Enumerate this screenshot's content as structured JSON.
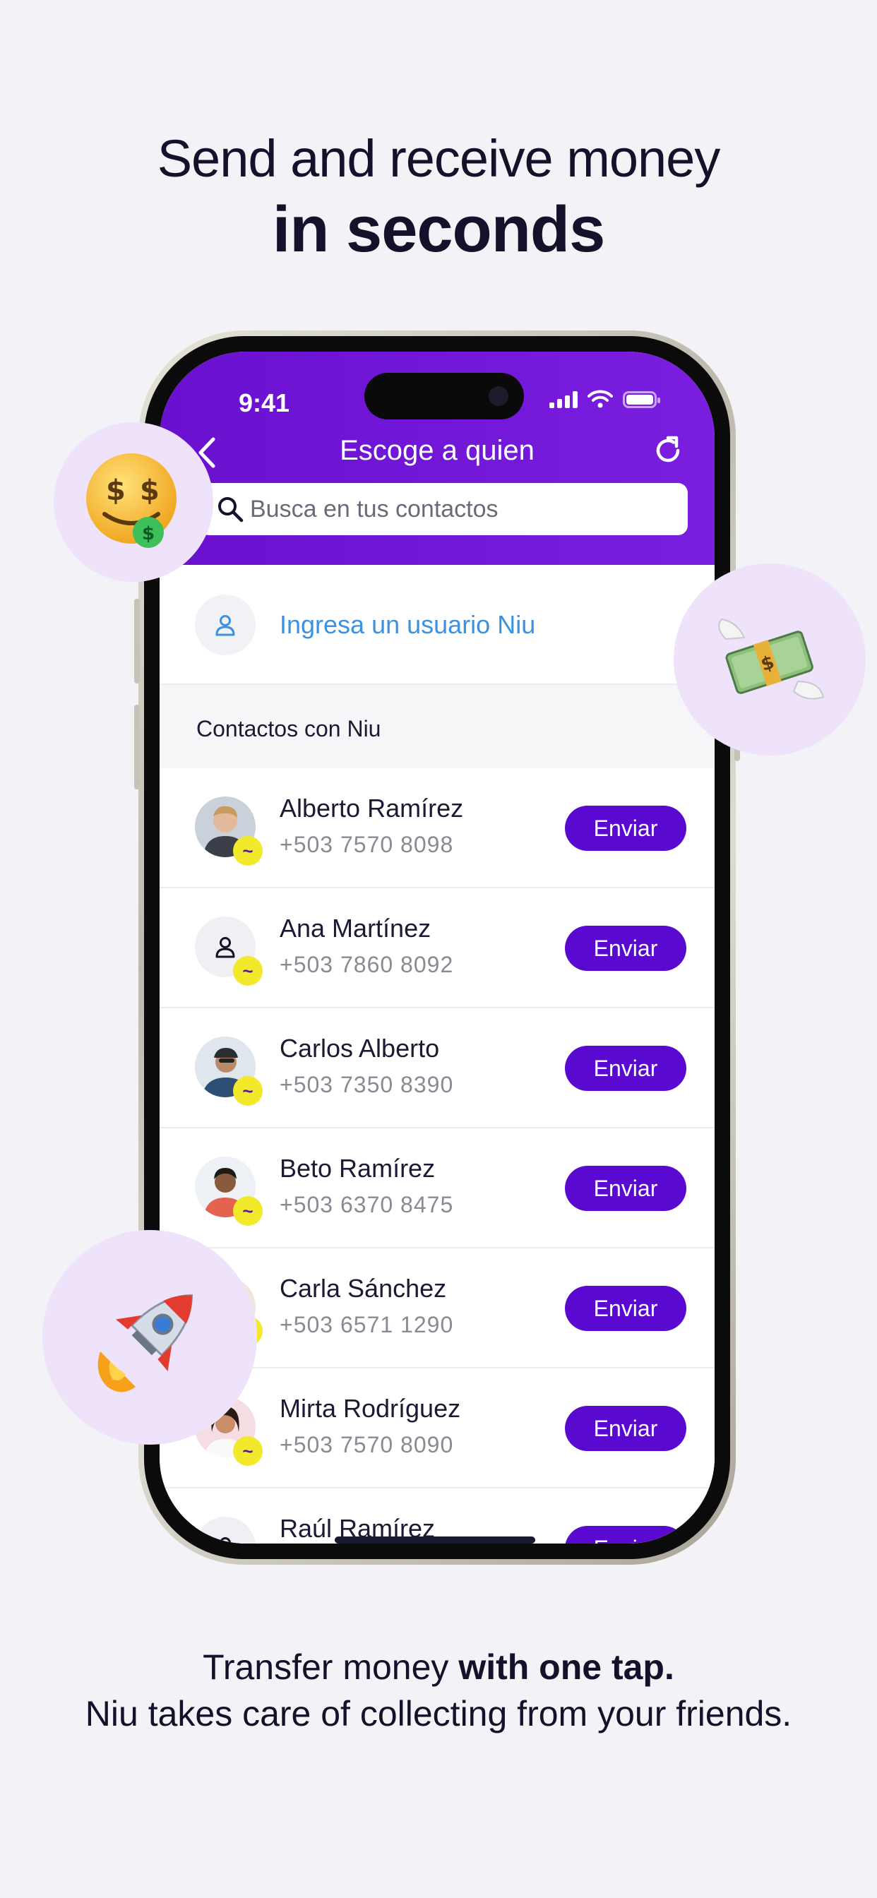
{
  "headline": {
    "line1": "Send and receive money",
    "line2": "in seconds"
  },
  "status_bar": {
    "time": "9:41"
  },
  "app": {
    "title": "Escoge a quien",
    "search_placeholder": "Busca en tus contactos",
    "user_entry_label": "Ingresa un usuario Niu",
    "section_title": "Contactos con Niu",
    "send_label": "Enviar",
    "accent_color": "#5a0ad0",
    "header_color": "#6a10cf",
    "badge_color": "#f2e92a",
    "link_color": "#3a92e0"
  },
  "contacts": [
    {
      "name": "Alberto Ramírez",
      "phone": "+503 7570 8098",
      "avatar": "photo"
    },
    {
      "name": "Ana Martínez",
      "phone": "+503 7860 8092",
      "avatar": "placeholder"
    },
    {
      "name": "Carlos Alberto",
      "phone": "+503 7350 8390",
      "avatar": "photo"
    },
    {
      "name": "Beto Ramírez",
      "phone": "+503 6370 8475",
      "avatar": "photo"
    },
    {
      "name": "Carla Sánchez",
      "phone": "+503 6571 1290",
      "avatar": "photo"
    },
    {
      "name": "Mirta Rodríguez",
      "phone": "+503 7570 8090",
      "avatar": "photo"
    },
    {
      "name": "Raúl Ramírez",
      "phone": "",
      "avatar": "placeholder"
    }
  ],
  "badge_glyph": "~",
  "emojis": {
    "money_face": "money-mouth-face-emoji",
    "flying_money": "money-with-wings-emoji",
    "rocket": "rocket-emoji"
  },
  "bottom_text": {
    "line1_prefix": "Transfer money ",
    "line1_bold": "with one tap.",
    "line2": "Niu takes care of collecting from your friends."
  }
}
